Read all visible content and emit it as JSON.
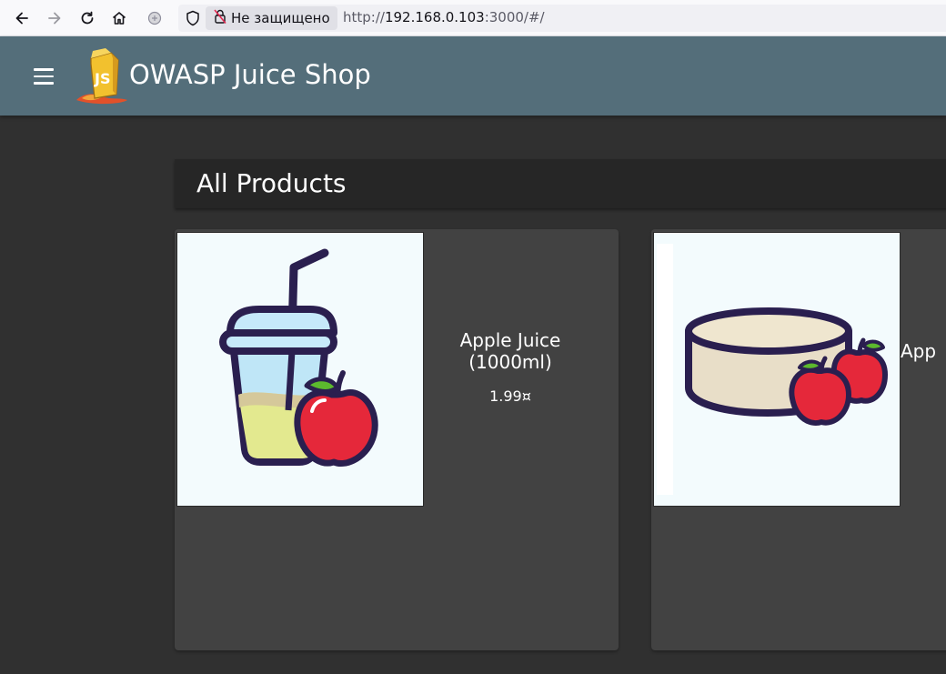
{
  "browser": {
    "security_label": "Не защищено",
    "url_prefix": "http://",
    "url_host": "192.168.0.103",
    "url_rest": ":3000/#/",
    "icons": [
      "back-icon",
      "forward-icon",
      "reload-icon",
      "home-icon",
      "extension-icon",
      "shield-icon",
      "insecure-lock-icon"
    ]
  },
  "app": {
    "title": "OWASP Juice Shop",
    "toolbar_color": "#546e7a",
    "menu_icon": "hamburger-menu-icon"
  },
  "main": {
    "heading": "All Products",
    "products": [
      {
        "name": "Apple Juice (1000ml)",
        "price": "1.99¤"
      },
      {
        "name": "App"
      }
    ]
  }
}
